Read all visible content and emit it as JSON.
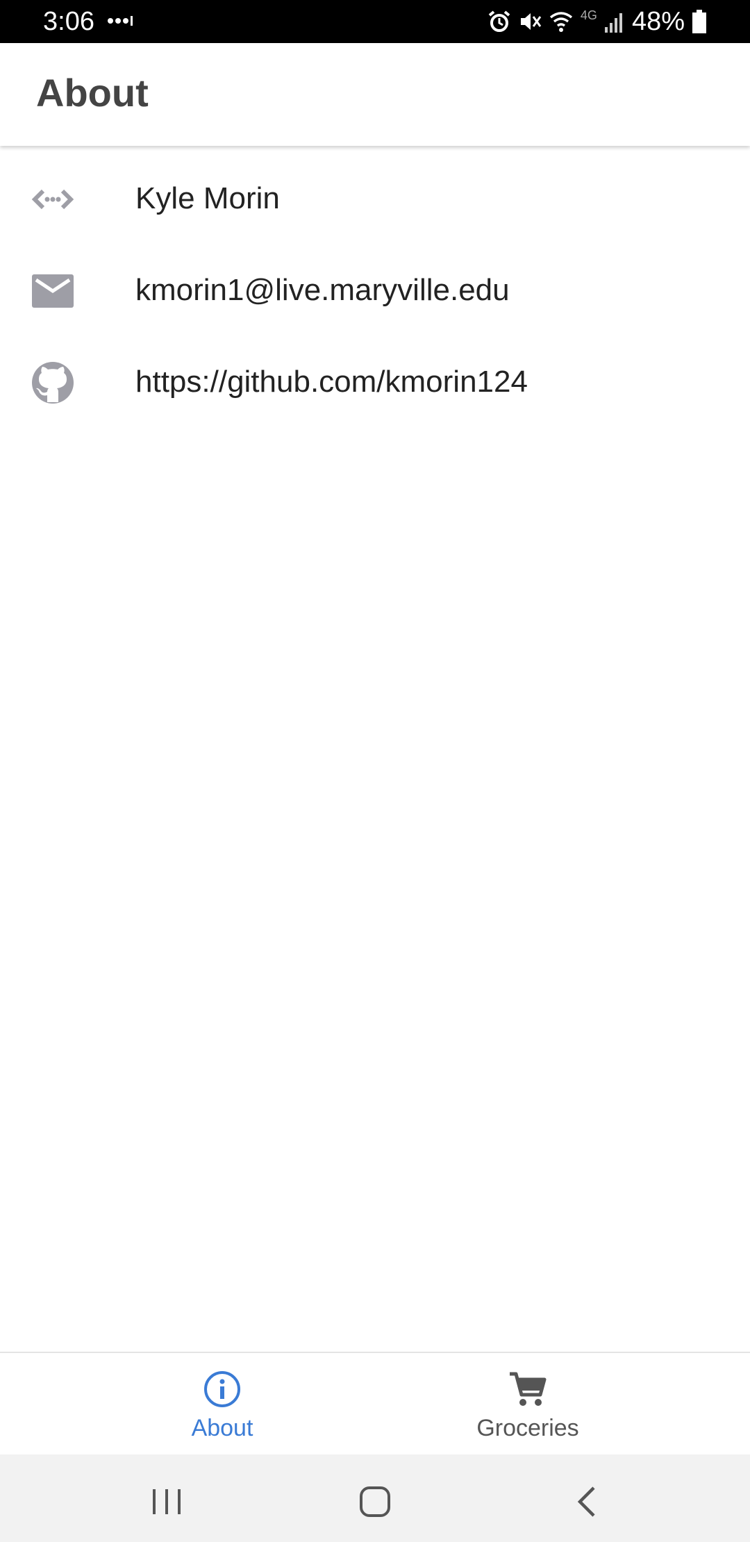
{
  "status_bar": {
    "time": "3:06",
    "battery": "48%",
    "network": "4G"
  },
  "app_bar": {
    "title": "About"
  },
  "contact": {
    "items": [
      {
        "icon": "code-icon",
        "text": "Kyle Morin"
      },
      {
        "icon": "mail-icon",
        "text": "kmorin1@live.maryville.edu"
      },
      {
        "icon": "github-icon",
        "text": "https://github.com/kmorin124"
      }
    ]
  },
  "bottom_nav": {
    "tabs": [
      {
        "label": "About",
        "icon": "info-icon",
        "active": true
      },
      {
        "label": "Groceries",
        "icon": "cart-icon",
        "active": false
      }
    ]
  },
  "colors": {
    "accent": "#3a7bd5",
    "icon_gray": "#9e9ea6",
    "text": "#222222"
  }
}
